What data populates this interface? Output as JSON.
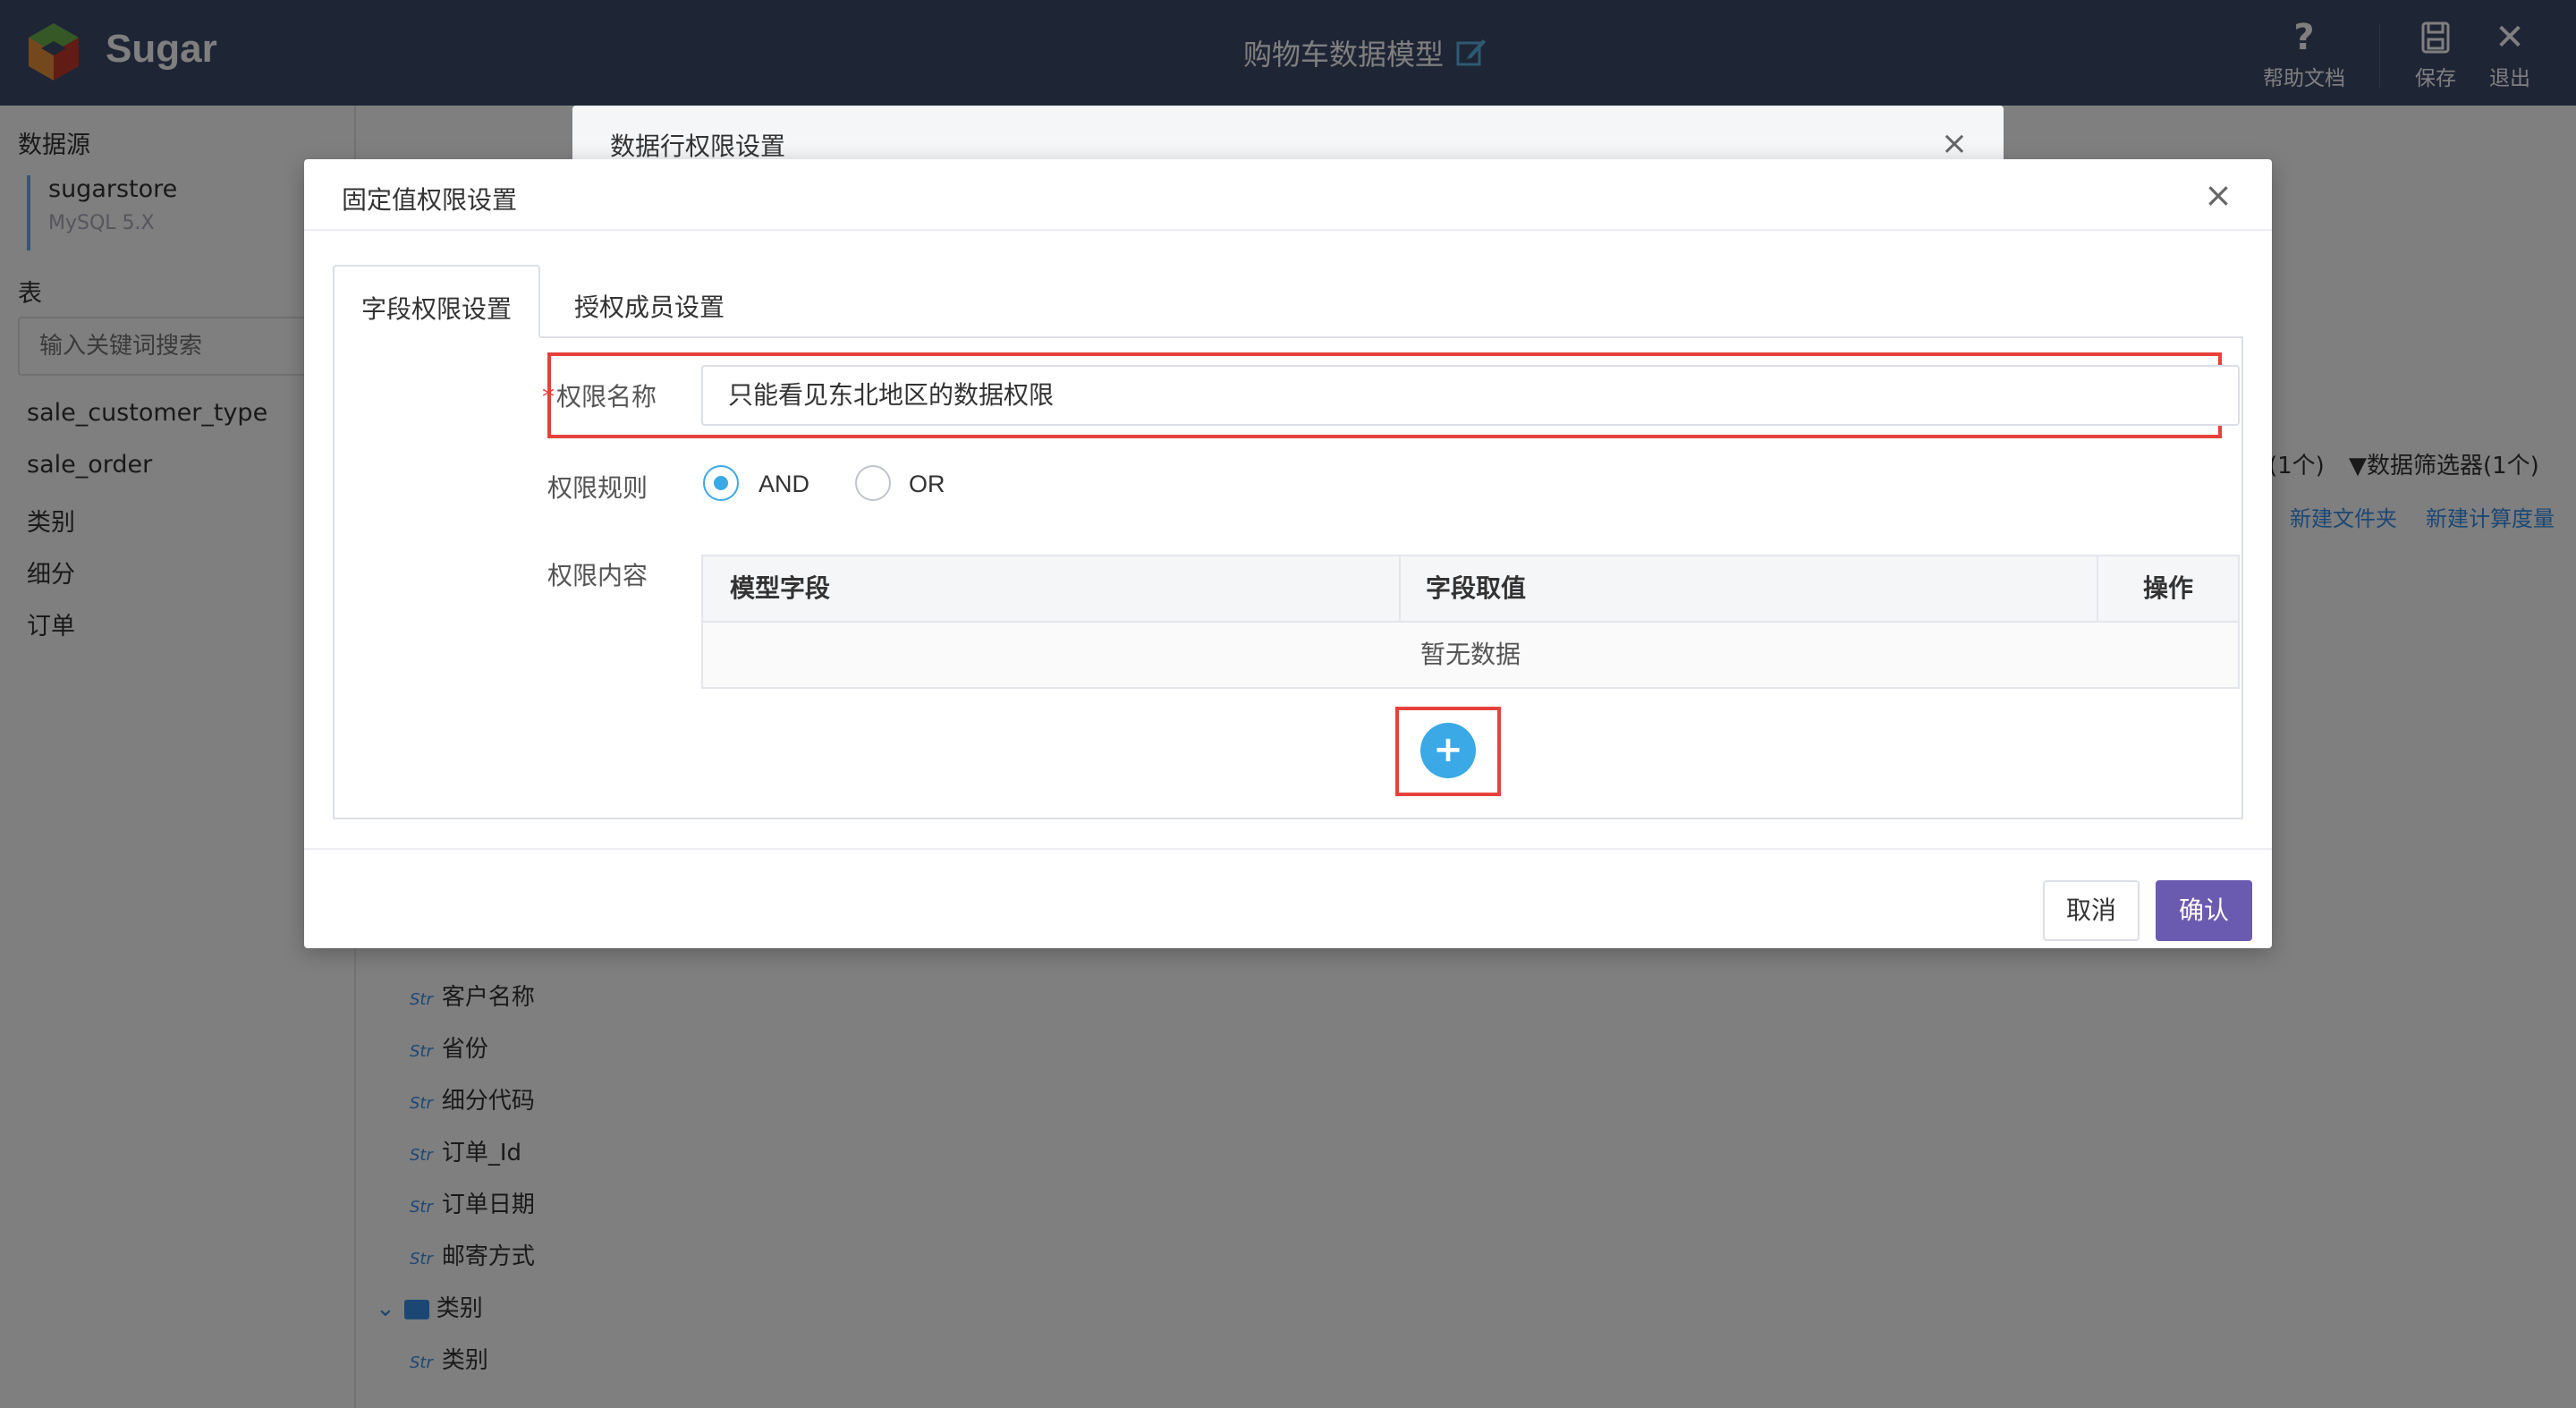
{
  "app": {
    "brand": "Sugar",
    "model_title": "购物车数据模型",
    "actions": {
      "help": "帮助文档",
      "save": "保存",
      "exit": "退出"
    }
  },
  "sidebar": {
    "datasource_heading": "数据源",
    "datasource_name": "sugarstore",
    "datasource_type": "MySQL 5.X",
    "tables_heading": "表",
    "search_placeholder": "输入关键词搜索",
    "tables": [
      "sale_customer_type",
      "sale_order",
      "类别",
      "细分",
      "订单"
    ]
  },
  "main": {
    "filter_tabs": [
      "(1个)",
      "数据筛选器(1个)"
    ],
    "links": [
      "新建文件夹",
      "新建计算度量"
    ],
    "fields": [
      {
        "type": "Str",
        "name": "客户名称"
      },
      {
        "type": "Str",
        "name": "省份"
      },
      {
        "type": "Str",
        "name": "细分代码"
      },
      {
        "type": "Str",
        "name": "订单_Id"
      },
      {
        "type": "Str",
        "name": "订单日期"
      },
      {
        "type": "Str",
        "name": "邮寄方式"
      }
    ],
    "folder": "类别",
    "folder_field": {
      "type": "Str",
      "name": "类别"
    }
  },
  "back_modal": {
    "title": "数据行权限设置"
  },
  "modal": {
    "title": "固定值权限设置",
    "tabs": [
      "字段权限设置",
      "授权成员设置"
    ],
    "form": {
      "name_label": "权限名称",
      "required_mark": "*",
      "name_value": "只能看见东北地区的数据权限",
      "rule_label": "权限规则",
      "rule_options": [
        "AND",
        "OR"
      ],
      "rule_selected": "AND",
      "content_label": "权限内容"
    },
    "grid": {
      "columns": [
        "模型字段",
        "字段取值",
        "操作"
      ],
      "empty_text": "暂无数据"
    },
    "add_symbol": "+",
    "footer": {
      "cancel": "取消",
      "ok": "确认"
    }
  },
  "colors": {
    "topbar": "#3d4a6b",
    "accent_blue": "#3aa9e6",
    "primary_purple": "#6b5bb0",
    "highlight_red": "#e6413b"
  }
}
